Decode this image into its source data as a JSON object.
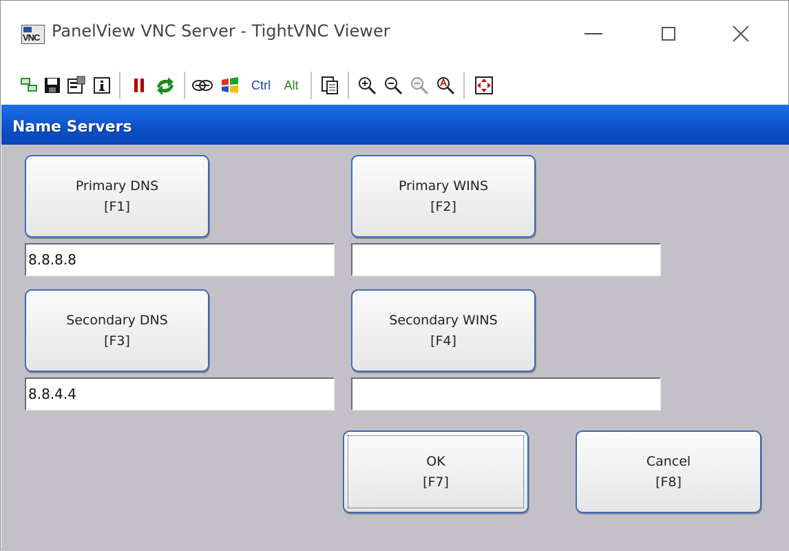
{
  "window": {
    "title": "PanelView VNC Server - TightVNC Viewer",
    "app_icon_text": "VNC"
  },
  "toolbar": {
    "ctrl_label": "Ctrl",
    "alt_label": "Alt",
    "icons": [
      "new-connection-icon",
      "save-icon",
      "options-icon",
      "info-icon",
      "pause-icon",
      "refresh-icon",
      "ctrl-alt-del-icon",
      "start-menu-icon",
      "ctrl-key",
      "alt-key",
      "clipboard-icon",
      "zoom-in-icon",
      "zoom-out-icon",
      "zoom-100-icon",
      "zoom-auto-icon",
      "fullscreen-icon"
    ]
  },
  "dialog": {
    "title": "Name Servers",
    "primary_dns": {
      "label": "Primary DNS",
      "key": "[F1]",
      "value": "8.8.8.8"
    },
    "primary_wins": {
      "label": "Primary WINS",
      "key": "[F2]",
      "value": ""
    },
    "secondary_dns": {
      "label": "Secondary DNS",
      "key": "[F3]",
      "value": "8.8.4.4"
    },
    "secondary_wins": {
      "label": "Secondary WINS",
      "key": "[F4]",
      "value": ""
    },
    "ok": {
      "label": "OK",
      "key": "[F7]"
    },
    "cancel": {
      "label": "Cancel",
      "key": "[F8]"
    }
  },
  "colors": {
    "header": "#0b4fc9",
    "panel_bg": "#c4c0c8",
    "button_border": "#3d6ab5"
  }
}
